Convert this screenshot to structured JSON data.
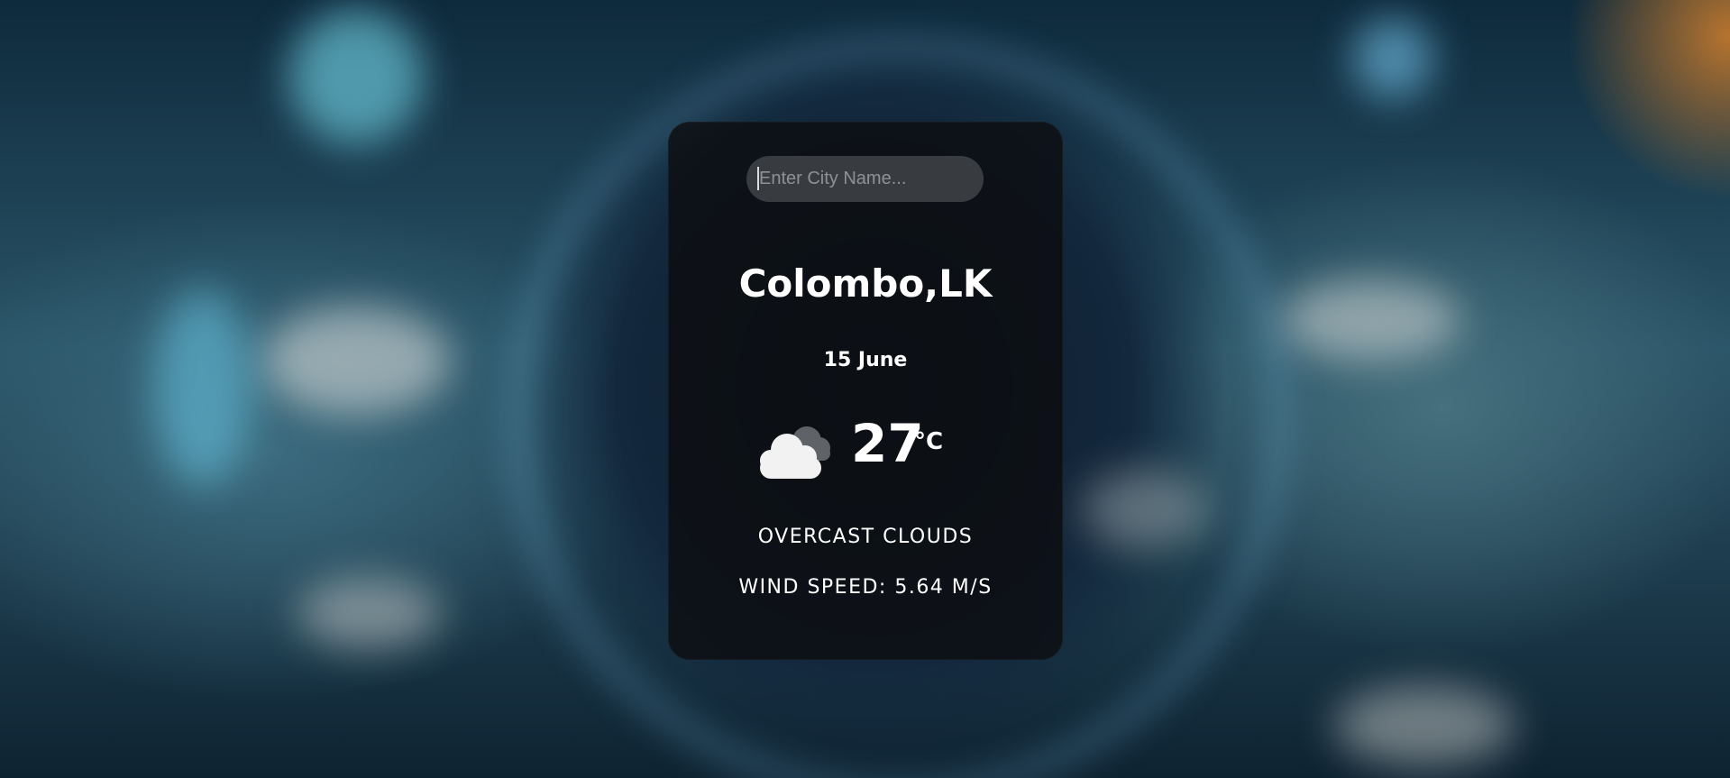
{
  "search": {
    "placeholder": "Enter City Name...",
    "value": ""
  },
  "weather": {
    "location": "Colombo,LK",
    "date": "15 June",
    "temperature": "27",
    "unit": "°C",
    "condition": "OVERCAST CLOUDS",
    "wind_speed": "WIND SPEED: 5.64 M/S",
    "icon": "overcast-clouds-icon"
  },
  "colors": {
    "card_background": "#0c0d10",
    "text": "#ffffff"
  }
}
